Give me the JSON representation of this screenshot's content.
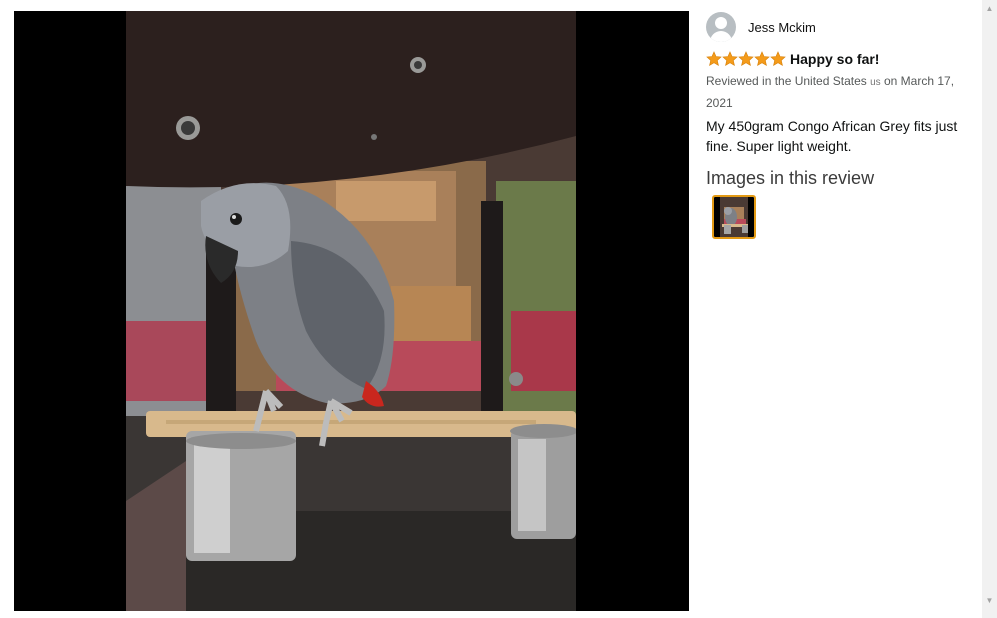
{
  "review": {
    "reviewer_name": "Jess Mckim",
    "rating": 5,
    "rating_max": 5,
    "title": "Happy so far!",
    "meta_prefix": "Reviewed in the United States ",
    "meta_flag": "us",
    "meta_suffix": " on March 17, 2021",
    "body": "My 450gram Congo African Grey fits just fine. Super light weight."
  },
  "images_section": {
    "title": "Images in this review",
    "thumbnail_count": 1
  },
  "colors": {
    "star": "#f49b1a",
    "thumbnail_border": "#e39a14",
    "viewer_background": "#000000"
  },
  "icons": {
    "avatar": "person-silhouette-icon",
    "star": "star-icon",
    "scroll_up": "triangle-up-icon",
    "scroll_down": "triangle-down-icon"
  }
}
